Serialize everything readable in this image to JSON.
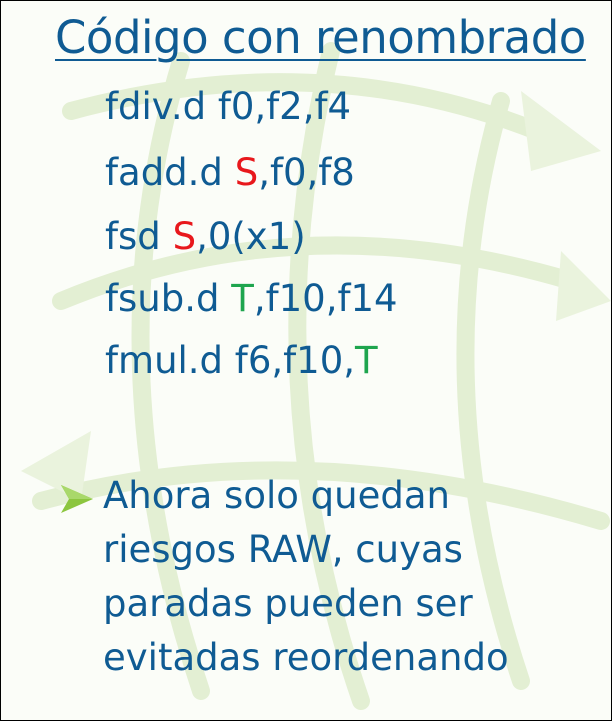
{
  "title": "Código con renombrado",
  "code": [
    [
      {
        "t": "fdiv.d f0,f2,f4",
        "c": ""
      }
    ],
    [
      {
        "t": "fadd.d ",
        "c": ""
      },
      {
        "t": "S",
        "c": "red"
      },
      {
        "t": ",f0,f8",
        "c": ""
      }
    ],
    [
      {
        "t": "fsd ",
        "c": ""
      },
      {
        "t": "S",
        "c": "red"
      },
      {
        "t": ",0(x1)",
        "c": ""
      }
    ],
    [
      {
        "t": "fsub.d ",
        "c": ""
      },
      {
        "t": "T",
        "c": "green"
      },
      {
        "t": ",f10,f14",
        "c": ""
      }
    ],
    [
      {
        "t": "fmul.d f6,f10,",
        "c": ""
      },
      {
        "t": "T",
        "c": "green"
      }
    ]
  ],
  "bullet": {
    "icon": "arrow-bullet-icon",
    "lines": [
      "Ahora solo quedan",
      "riesgos RAW, cuyas",
      "paradas pueden ser",
      "evitadas reordenando"
    ]
  },
  "colors": {
    "text": "#0f5b93",
    "renamed_S": "#e8181c",
    "renamed_T": "#1ea54e",
    "bullet_arrow": "#8cc63f",
    "background_art": "#e3efd3"
  }
}
